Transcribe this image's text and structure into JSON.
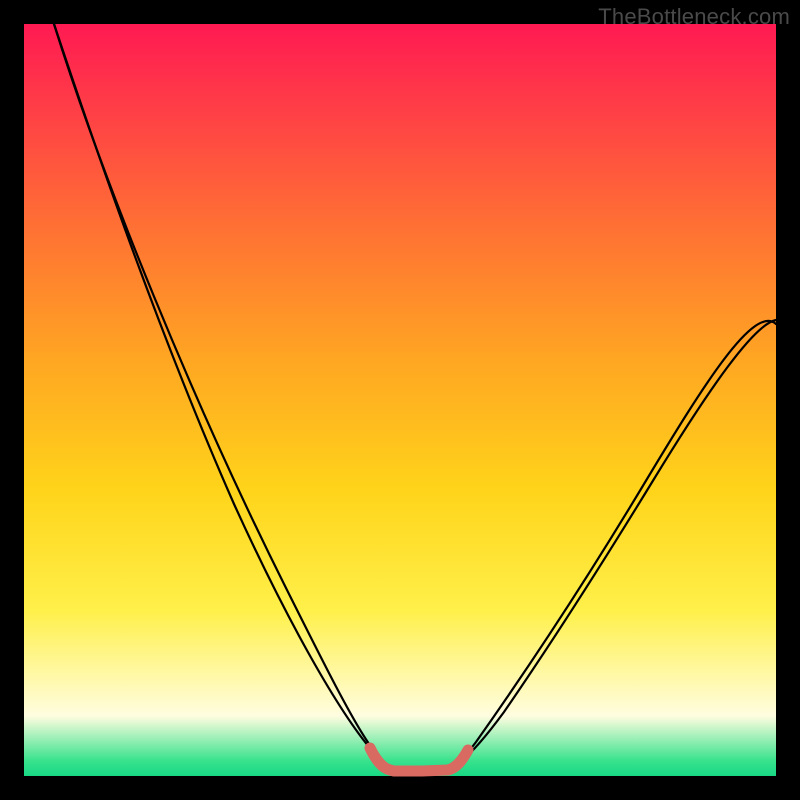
{
  "watermark": "TheBottleneck.com",
  "colors": {
    "frame": "#000000",
    "gradient_top": "#ff1a52",
    "gradient_mid1": "#ff6a36",
    "gradient_mid2": "#ffd41a",
    "gradient_low": "#fffde0",
    "gradient_bottom": "#18d884",
    "curve": "#000000",
    "accent_segment": "#d86a62"
  },
  "chart_data": {
    "type": "line",
    "title": "",
    "xlabel": "",
    "ylabel": "",
    "xlim": [
      0,
      100
    ],
    "ylim": [
      0,
      100
    ],
    "grid": false,
    "legend": false,
    "note": "Values estimated from pixel positions; y is relative bottleneck magnitude (0 = no bottleneck at valley, 100 = top of chart).",
    "series": [
      {
        "name": "bottleneck-curve",
        "x": [
          4,
          10,
          15,
          20,
          25,
          30,
          35,
          40,
          43,
          46,
          48,
          50,
          52,
          54,
          56,
          58,
          62,
          70,
          80,
          90,
          100
        ],
        "y": [
          100,
          88,
          78,
          68,
          58,
          47,
          36,
          22,
          12,
          5,
          2,
          1,
          1,
          1,
          2,
          4,
          8,
          18,
          32,
          46,
          60
        ]
      },
      {
        "name": "valley-accent",
        "x": [
          46,
          48,
          49,
          50,
          51,
          52,
          53,
          54,
          55,
          56,
          57
        ],
        "y": [
          5,
          2,
          1.2,
          1,
          1,
          1,
          1,
          1.2,
          2,
          3,
          4.5
        ]
      }
    ]
  }
}
